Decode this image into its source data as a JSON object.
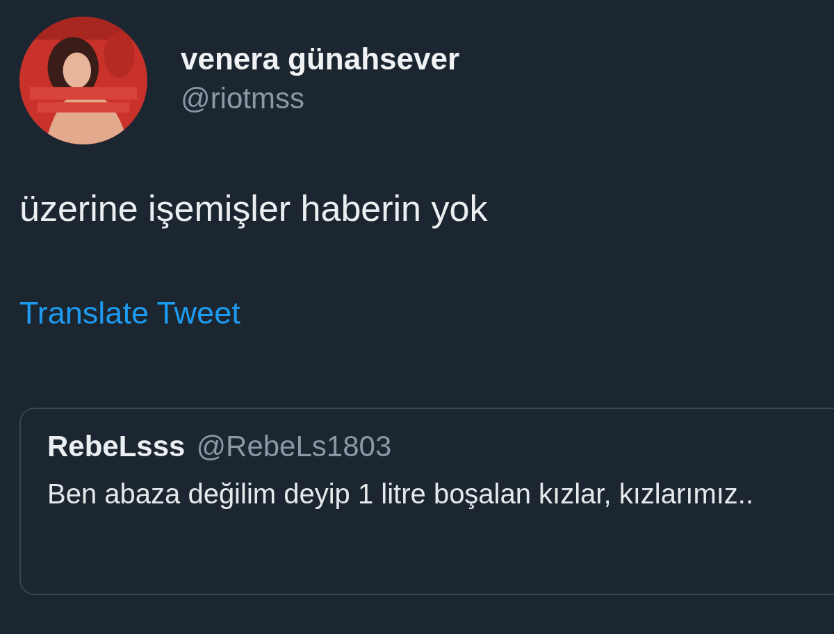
{
  "author": {
    "name": "venera günahsever",
    "handle": "@riotmss"
  },
  "tweet": {
    "text": "üzerine işemişler haberin yok",
    "translate_link": "Translate Tweet"
  },
  "quoted_tweet": {
    "name": "RebeLsss",
    "handle": "@RebeLs1803",
    "text": "Ben abaza değilim deyip 1 litre boşalan kızlar, kızlarımız.."
  }
}
